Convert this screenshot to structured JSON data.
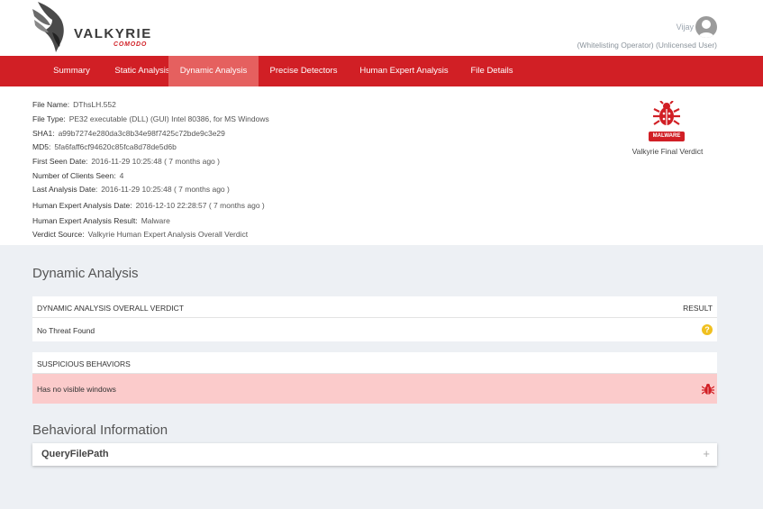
{
  "brand": {
    "name": "VALKYRIE",
    "sub": "COMODO"
  },
  "user": {
    "name": "Vijay",
    "role": "(Whitelisting Operator) (Unlicensed User)"
  },
  "nav": {
    "tabs": [
      {
        "label": "Summary"
      },
      {
        "label": "Static Analysis"
      },
      {
        "label": "Dynamic Analysis",
        "active": true
      },
      {
        "label": "Precise Detectors"
      },
      {
        "label": "Human Expert Analysis"
      },
      {
        "label": "File Details"
      }
    ]
  },
  "file_info": {
    "file_name": {
      "label": "File Name:",
      "value": "DThsLH.552"
    },
    "file_type": {
      "label": "File Type:",
      "value": "PE32 executable (DLL) (GUI) Intel 80386, for MS Windows"
    },
    "sha1": {
      "label": "SHA1:",
      "value": "a99b7274e280da3c8b34e98f7425c72bde9c3e29"
    },
    "md5": {
      "label": "MD5:",
      "value": "5fa6faff6cf94620c85fca8d78de5d6b"
    },
    "first_seen": {
      "label": "First Seen Date:",
      "value": "2016-11-29 10:25:48 ( 7 months ago )"
    },
    "clients_seen": {
      "label": "Number of Clients Seen:",
      "value": "4"
    },
    "last_analysis": {
      "label": "Last Analysis Date:",
      "value": "2016-11-29 10:25:48 ( 7 months ago )"
    },
    "hea_date": {
      "label": "Human Expert Analysis Date:",
      "value": "2016-12-10 22:28:57 ( 7 months ago )"
    },
    "hea_result": {
      "label": "Human Expert Analysis Result:",
      "value": "Malware"
    },
    "verdict_source": {
      "label": "Verdict Source:",
      "value": "Valkyrie Human Expert Analysis Overall Verdict"
    }
  },
  "verdict": {
    "badge": "MALWARE",
    "caption": "Valkyrie Final Verdict",
    "color": "#d11f25"
  },
  "dynamic": {
    "title": "Dynamic Analysis",
    "overall_header": "DYNAMIC ANALYSIS OVERALL VERDICT",
    "result_header": "RESULT",
    "overall_value": "No Threat Found",
    "overall_icon": "question-icon",
    "suspicious_header": "SUSPICIOUS BEHAVIORS",
    "suspicious_rows": [
      {
        "text": "Has no visible windows",
        "icon": "bug-icon"
      }
    ]
  },
  "behavioral": {
    "title": "Behavioral Information",
    "items": [
      {
        "label": "QueryFilePath",
        "expand_symbol": "+"
      }
    ]
  }
}
